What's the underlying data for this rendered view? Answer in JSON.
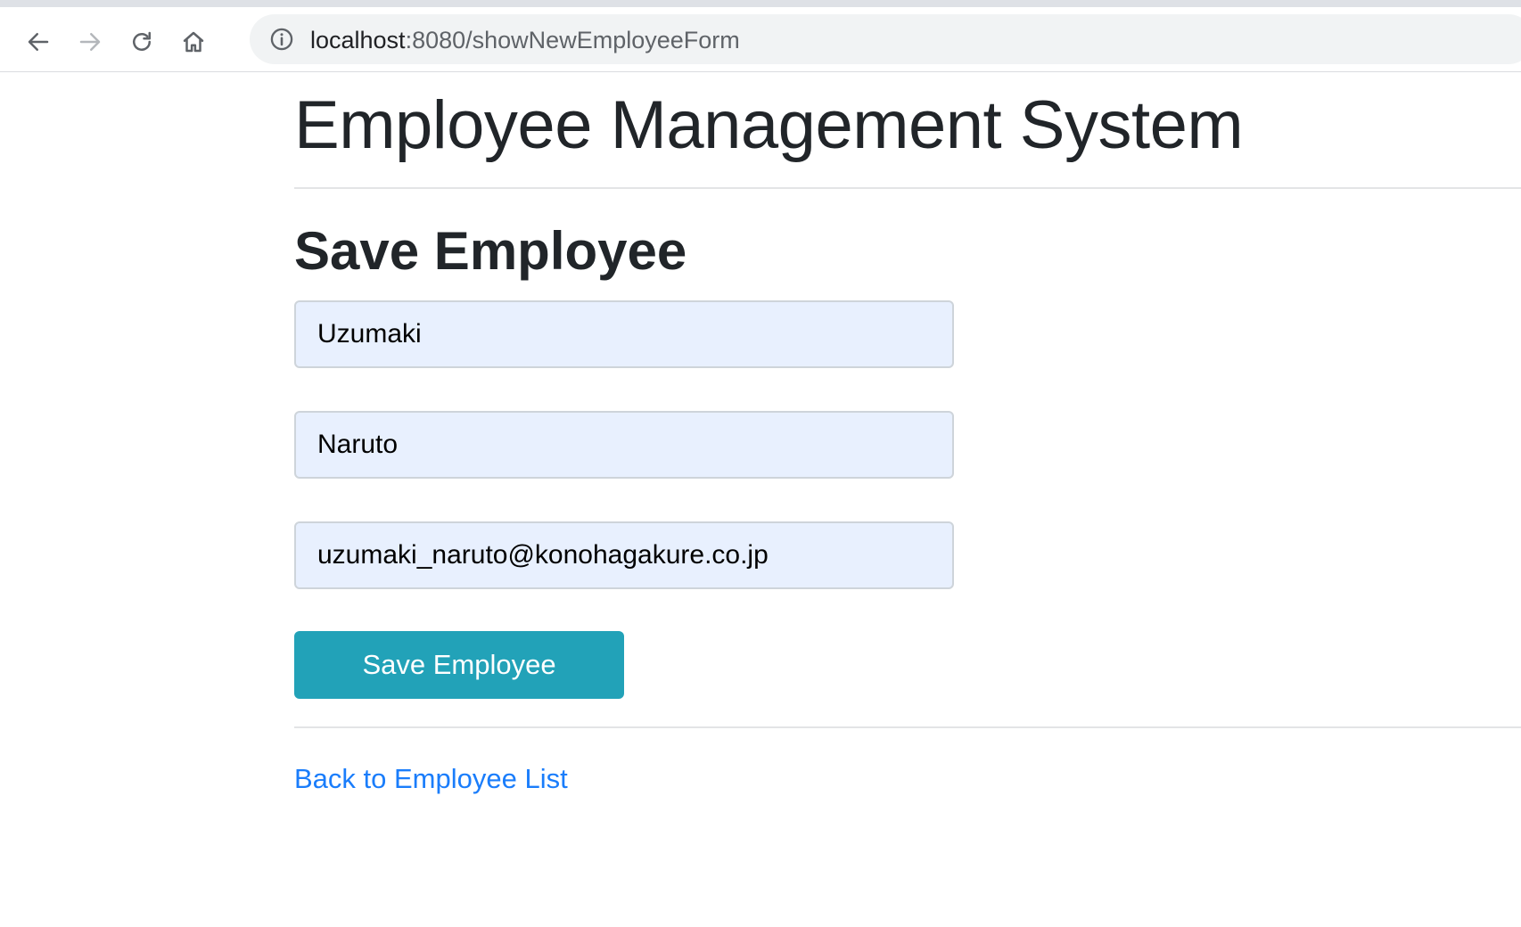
{
  "browser": {
    "url_host": "localhost",
    "url_path": ":8080/showNewEmployeeForm",
    "icons": [
      "back-arrow-icon",
      "forward-arrow-icon",
      "reload-icon",
      "home-icon",
      "info-icon"
    ]
  },
  "page": {
    "title": "Employee Management System",
    "section_title": "Save Employee"
  },
  "form": {
    "first_field_value": "Uzumaki",
    "second_field_value": "Naruto",
    "email_field_value": "uzumaki_naruto@konohagakure.co.jp",
    "submit_label": "Save Employee"
  },
  "footer": {
    "back_link_label": "Back to Employee List"
  },
  "colors": {
    "button": "#22a2b8",
    "link": "#1a7dfb",
    "autofill": "#e8f0fe"
  }
}
